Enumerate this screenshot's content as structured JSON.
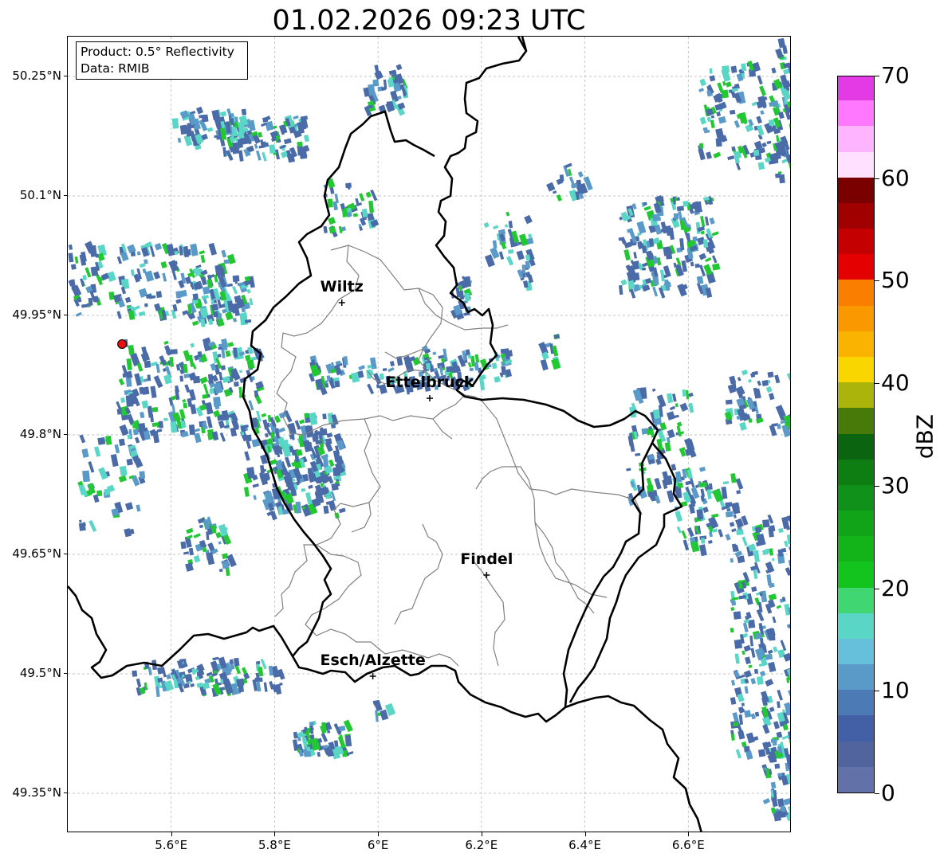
{
  "title": "01.02.2026 09:23 UTC",
  "info": {
    "product": "Product: 0.5° Reflectivity",
    "source": "Data: RMIB"
  },
  "axes": {
    "lat_labels": [
      "50.25°N",
      "50.1°N",
      "49.95°N",
      "49.8°N",
      "49.65°N",
      "49.5°N",
      "49.35°N"
    ],
    "lat_values": [
      50.25,
      50.1,
      49.95,
      49.8,
      49.65,
      49.5,
      49.35
    ],
    "lon_labels": [
      "5.6°E",
      "5.8°E",
      "6°E",
      "6.2°E",
      "6.4°E",
      "6.6°E"
    ],
    "lon_values": [
      5.6,
      5.8,
      6.0,
      6.2,
      6.4,
      6.6
    ],
    "lon_range": [
      5.4,
      6.8
    ],
    "lat_range": [
      49.3,
      50.3
    ],
    "gridlines": true
  },
  "cities": [
    {
      "name": "Wiltz",
      "lon": 5.93,
      "lat": 49.966
    },
    {
      "name": "Ettelbruck",
      "lon": 6.1,
      "lat": 49.846
    },
    {
      "name": "Findel",
      "lon": 6.21,
      "lat": 49.624
    },
    {
      "name": "Esch/Alzette",
      "lon": 5.99,
      "lat": 49.497
    }
  ],
  "radar_site": {
    "lon": 5.505,
    "lat": 49.914,
    "color": "#e81010"
  },
  "colorbar": {
    "label": "dBZ",
    "min": 0,
    "max": 70,
    "step": 2.5,
    "tick_labels": [
      "0",
      "10",
      "20",
      "30",
      "40",
      "50",
      "60",
      "70"
    ],
    "tick_values": [
      0,
      10,
      20,
      30,
      40,
      50,
      60,
      70
    ],
    "colors": [
      "#6272a8",
      "#52649e",
      "#4360a6",
      "#4b7ab4",
      "#5a9ac8",
      "#66c0dc",
      "#5ad6c6",
      "#40d672",
      "#14c41e",
      "#12b41a",
      "#12a418",
      "#10921a",
      "#0e7e12",
      "#0b6410",
      "#487a0a",
      "#aab40a",
      "#fad600",
      "#fab400",
      "#fa9800",
      "#fa7e00",
      "#e40000",
      "#c40000",
      "#a00000",
      "#7a0000",
      "#ffe0ff",
      "#ffb4ff",
      "#ff78ff",
      "#e43ae6"
    ]
  },
  "colors": {
    "border_national": "#000000",
    "border_canton": "#808080",
    "grid": "#b0b0b0",
    "echo_main": "#4a6aa8",
    "echo_light": "#5a9ac8",
    "echo_cyan": "#5ad6c6",
    "echo_green": "#22c832"
  }
}
